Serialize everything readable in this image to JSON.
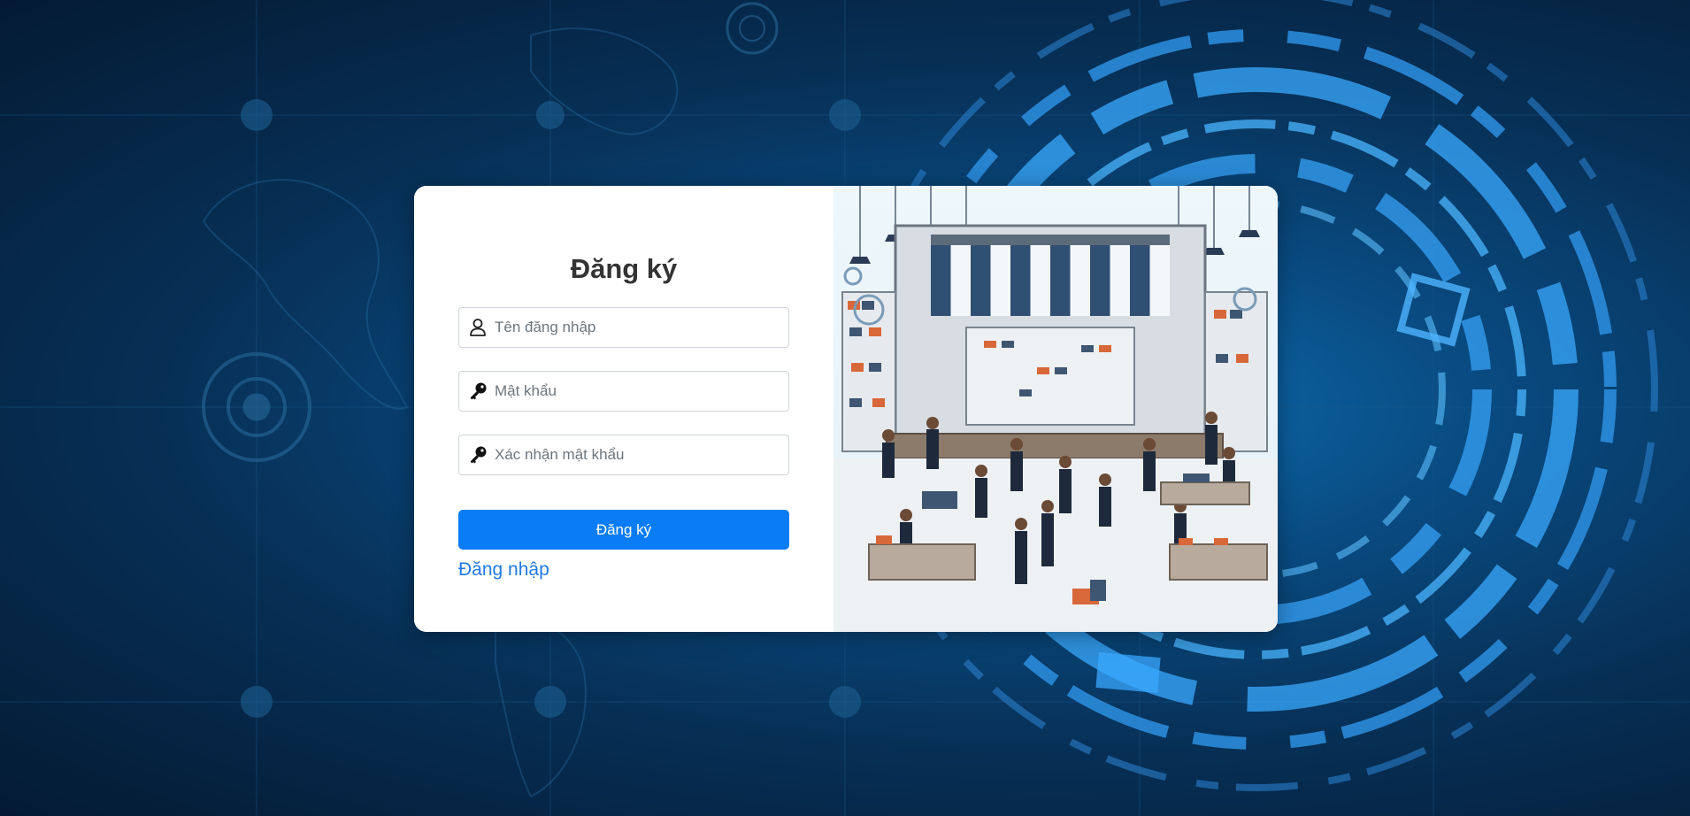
{
  "register_form": {
    "title": "Đăng ký",
    "username_placeholder": "Tên đăng nhập",
    "password_placeholder": "Mật khẩu",
    "confirm_password_placeholder": "Xác nhận mật khẩu",
    "submit_label": "Đăng ký",
    "login_link_label": "Đăng nhập"
  },
  "icons": {
    "username": "user-icon",
    "password": "key-icon",
    "confirm_password": "key-icon"
  },
  "colors": {
    "primary_button": "#0a7cf5",
    "link": "#1f7ae0",
    "background": "#072f55"
  }
}
